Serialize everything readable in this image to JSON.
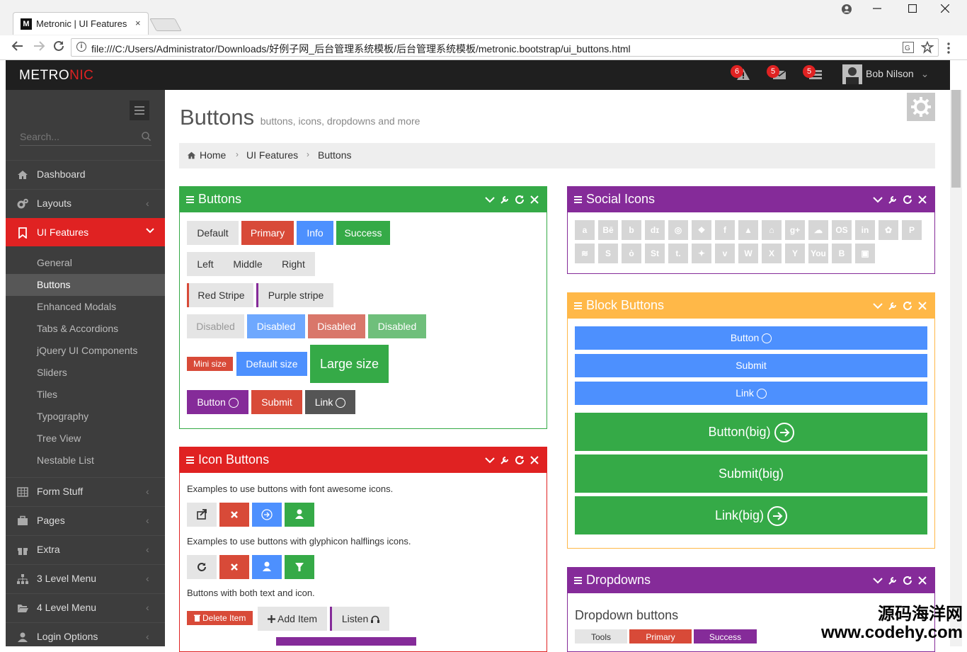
{
  "browser": {
    "tab_title": "Metronic | UI Features",
    "tab_favicon": "M",
    "tab_close": "×",
    "url": "file:///C:/Users/Administrator/Downloads/好例子网_后台管理系统模板/后台管理系统模板/metronic.bootstrap/ui_buttons.html",
    "icons": [
      "back-icon",
      "forward-icon",
      "reload-icon",
      "info-icon",
      "translate-icon",
      "star-icon",
      "kebab-menu-icon",
      "account-icon",
      "minimize-icon",
      "maximize-icon",
      "close-icon"
    ]
  },
  "header": {
    "logo_a": "METRO",
    "logo_b": "NIC",
    "notifications": [
      {
        "icon": "warning-icon",
        "count": "6"
      },
      {
        "icon": "envelope-icon",
        "count": "5"
      },
      {
        "icon": "tasks-icon",
        "count": "5"
      }
    ],
    "user_name": "Bob Nilson",
    "user_caret": "⌄"
  },
  "sidebar": {
    "search_placeholder": "Search...",
    "items": [
      {
        "label": "Dashboard",
        "icon": "home-icon",
        "arrow": ""
      },
      {
        "label": "Layouts",
        "icon": "cogs-icon",
        "arrow": "‹"
      },
      {
        "label": "UI Features",
        "icon": "bookmark-icon",
        "arrow": "⌄"
      },
      {
        "label": "Form Stuff",
        "icon": "table-icon",
        "arrow": "‹"
      },
      {
        "label": "Pages",
        "icon": "briefcase-icon",
        "arrow": "‹"
      },
      {
        "label": "Extra",
        "icon": "gift-icon",
        "arrow": "‹"
      },
      {
        "label": "3 Level Menu",
        "icon": "sitemap-icon",
        "arrow": "‹"
      },
      {
        "label": "4 Level Menu",
        "icon": "folder-open-icon",
        "arrow": "‹"
      },
      {
        "label": "Login Options",
        "icon": "user-icon",
        "arrow": "‹"
      }
    ],
    "subitems": [
      "General",
      "Buttons",
      "Enhanced Modals",
      "Tabs & Accordions",
      "jQuery UI Components",
      "Sliders",
      "Tiles",
      "Typography",
      "Tree View",
      "Nestable List"
    ],
    "active_subitem": "Buttons"
  },
  "page": {
    "title": "Buttons",
    "subtitle": "buttons, icons, dropdowns and more",
    "breadcrumb": [
      "Home",
      "UI Features",
      "Buttons"
    ]
  },
  "buttons_portlet": {
    "title": "Buttons",
    "row1": [
      "Default",
      "Primary",
      "Info",
      "Success"
    ],
    "row2": [
      "Left",
      "Middle",
      "Right"
    ],
    "row3": [
      "Red Stripe",
      "Purple stripe"
    ],
    "row4": [
      "Disabled",
      "Disabled",
      "Disabled",
      "Disabled"
    ],
    "row5": [
      "Mini size",
      "Default size",
      "Large size"
    ],
    "row6": [
      "Button",
      "Submit",
      "Link"
    ]
  },
  "icon_buttons_portlet": {
    "title": "Icon Buttons",
    "text1": "Examples to use buttons with font awesome icons.",
    "text2": "Examples to use buttons with glyphicon halflings icons.",
    "text3": "Buttons with both text and icon.",
    "fa_icons": [
      "share-icon",
      "times-icon",
      "circle-arrow-icon",
      "user-icon"
    ],
    "glyph_icons": [
      "repeat-icon",
      "remove-icon",
      "user-icon",
      "filter-icon"
    ],
    "text_buttons": [
      "Delete Item",
      "Add Item",
      "Listen"
    ]
  },
  "social_portlet": {
    "title": "Social Icons",
    "row1": [
      "a",
      "Bē",
      "b",
      "dɪ",
      "◎",
      "❖",
      "f",
      "▲",
      "⌂",
      "g+",
      "☁",
      "OS",
      "in",
      "✿",
      "P"
    ],
    "row2": [
      "≋",
      "S",
      "ȯ",
      "St",
      "t.",
      "✦",
      "v",
      "W",
      "X",
      "Y",
      "You",
      "B",
      "▣"
    ]
  },
  "block_portlet": {
    "title": "Block Buttons",
    "small": [
      "Button",
      "Submit",
      "Link"
    ],
    "big": [
      "Button(big)",
      "Submit(big)",
      "Link(big)"
    ]
  },
  "dropdowns_portlet": {
    "title": "Dropdowns",
    "subtitle": "Dropdown buttons",
    "buttons": [
      "Tools",
      "Primary",
      "Success"
    ]
  },
  "watermark": {
    "line1": "源码海洋网",
    "line2": "www.codehy.com"
  },
  "colors": {
    "green": "#35aa47",
    "red": "#e02222",
    "blue": "#4d90fe",
    "purple": "#852b99",
    "yellow": "#ffb848",
    "dark": "#555555",
    "header": "#1f1f1f",
    "sidebar": "#3d3d3d"
  }
}
